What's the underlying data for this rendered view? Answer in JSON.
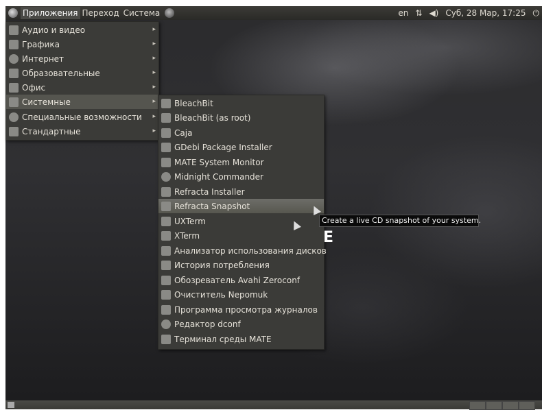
{
  "top_panel": {
    "menus": [
      "Приложения",
      "Переход",
      "Система"
    ],
    "keyboard_layout": "en",
    "datetime": "Суб, 28 Мар, 17:25",
    "network_icon": "network-arrows-icon",
    "volume_icon": "speaker-icon",
    "power_icon": "power-icon"
  },
  "apps_menu": {
    "items": [
      {
        "label": "Аудио и видео",
        "icon": "multimedia-icon"
      },
      {
        "label": "Графика",
        "icon": "graphics-icon"
      },
      {
        "label": "Интернет",
        "icon": "internet-icon"
      },
      {
        "label": "Образовательные",
        "icon": "education-icon"
      },
      {
        "label": "Офис",
        "icon": "office-icon"
      },
      {
        "label": "Системные",
        "icon": "system-icon"
      },
      {
        "label": "Специальные возможности",
        "icon": "accessibility-icon"
      },
      {
        "label": "Стандартные",
        "icon": "accessories-icon"
      }
    ]
  },
  "system_menu": {
    "items": [
      {
        "label": "BleachBit"
      },
      {
        "label": "BleachBit (as root)"
      },
      {
        "label": "Caja"
      },
      {
        "label": "GDebi Package Installer"
      },
      {
        "label": "MATE System Monitor"
      },
      {
        "label": "Midnight Commander"
      },
      {
        "label": "Refracta Installer"
      },
      {
        "label": "Refracta Snapshot"
      },
      {
        "label": "UXTerm"
      },
      {
        "label": "XTerm"
      },
      {
        "label": "Анализатор использования дисков"
      },
      {
        "label": "История потребления"
      },
      {
        "label": "Обозреватель Avahi Zeroconf"
      },
      {
        "label": "Очиститель Nepomuk"
      },
      {
        "label": "Программа просмотра журналов"
      },
      {
        "label": "Редактор dconf"
      },
      {
        "label": "Терминал среды MATE"
      }
    ]
  },
  "tooltip": "Create a live CD snapshot of your system.",
  "background_letter": "E",
  "colors": {
    "panel": "#3c3b37",
    "menu_bg": "#3b3b38",
    "highlight": "#6d6d68"
  }
}
